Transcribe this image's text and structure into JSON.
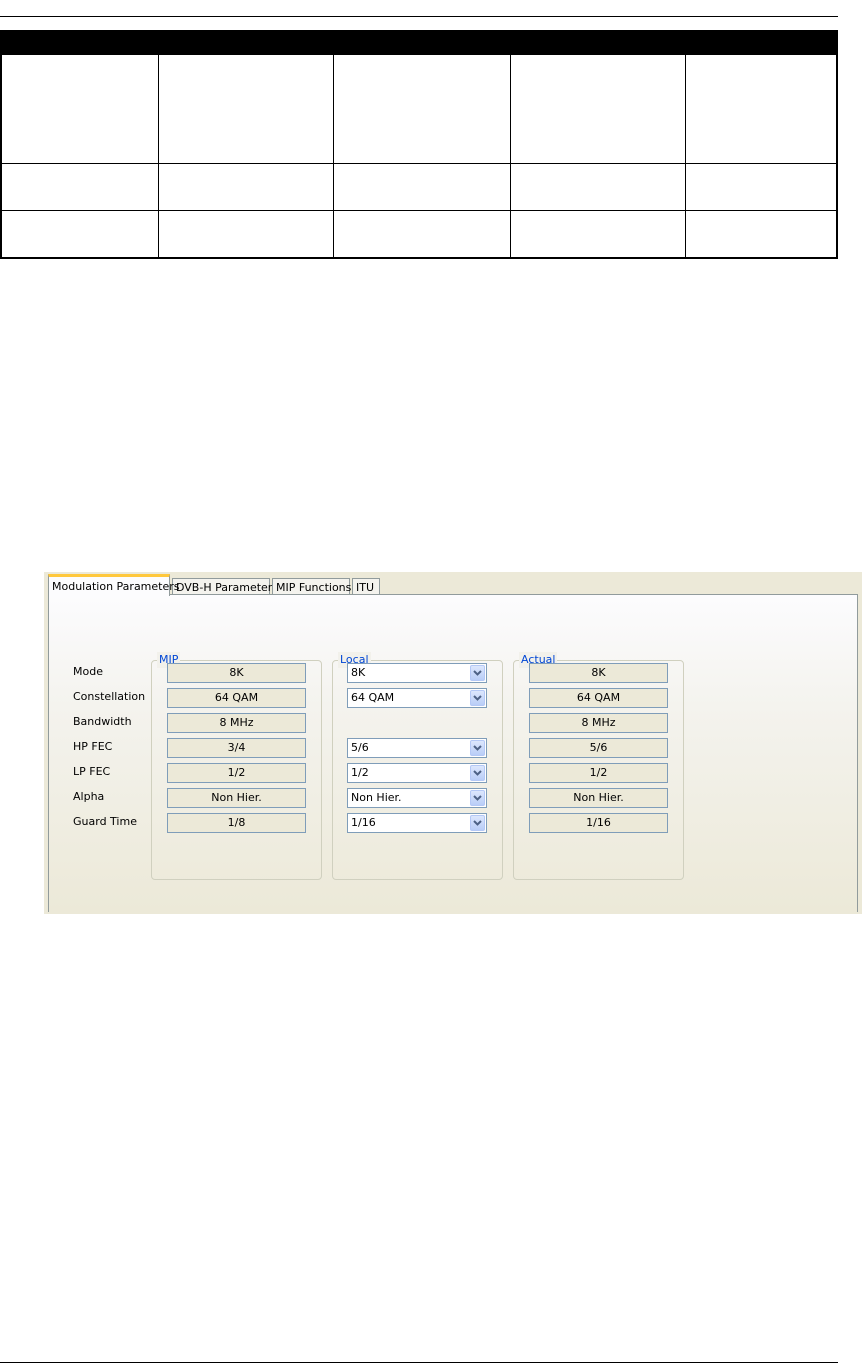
{
  "tabs": [
    {
      "label": "Modulation Parameters",
      "active": true
    },
    {
      "label": "DVB-H Parameters",
      "active": false
    },
    {
      "label": "MIP Functions",
      "active": false
    },
    {
      "label": "ITU",
      "active": false
    }
  ],
  "groups": {
    "mip": "MIP",
    "local": "Local",
    "actual": "Actual"
  },
  "rows": [
    {
      "label": "Mode",
      "mip": "8K",
      "local": "8K",
      "actual": "8K"
    },
    {
      "label": "Constellation",
      "mip": "64 QAM",
      "local": "64 QAM",
      "actual": "64 QAM"
    },
    {
      "label": "Bandwidth",
      "mip": "8 MHz",
      "local": null,
      "actual": "8 MHz"
    },
    {
      "label": "HP FEC",
      "mip": "3/4",
      "local": "5/6",
      "actual": "5/6"
    },
    {
      "label": "LP FEC",
      "mip": "1/2",
      "local": "1/2",
      "actual": "1/2"
    },
    {
      "label": "Alpha",
      "mip": "Non Hier.",
      "local": "Non Hier.",
      "actual": "Non Hier."
    },
    {
      "label": "Guard Time",
      "mip": "1/8",
      "local": "1/16",
      "actual": "1/16"
    }
  ],
  "colors": {
    "group_title": "#0046d5",
    "active_tab_accent": "#ffc83c",
    "panel_bg": "#ece9d8",
    "field_border": "#7f9db9"
  }
}
